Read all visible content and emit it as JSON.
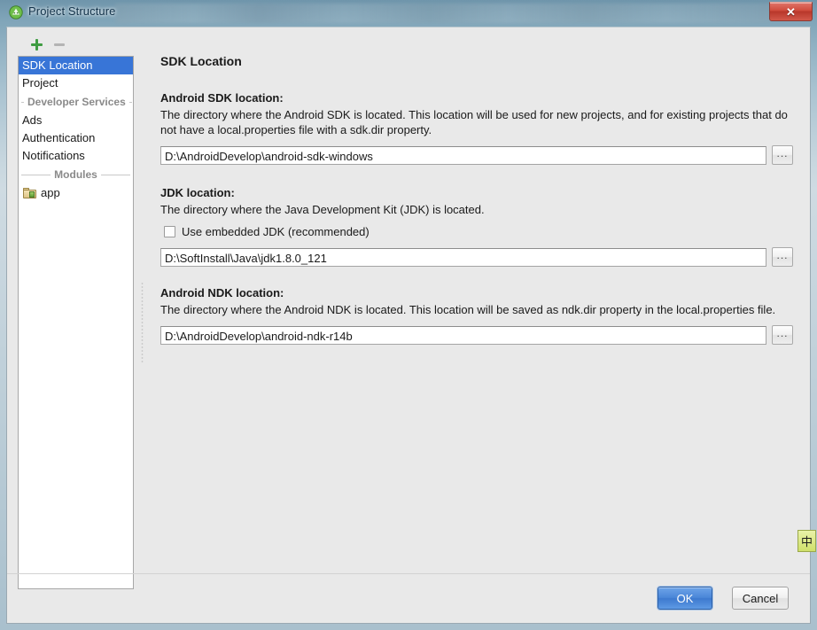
{
  "window": {
    "title": "Project Structure",
    "app_icon": "android-studio-icon",
    "close_label": "✕"
  },
  "sidebar": {
    "toolbar": {
      "add_label": "+",
      "remove_label": "−"
    },
    "items": [
      {
        "label": "SDK Location",
        "type": "item",
        "selected": true
      },
      {
        "label": "Project",
        "type": "item",
        "selected": false
      },
      {
        "label": "Developer Services",
        "type": "separator"
      },
      {
        "label": "Ads",
        "type": "item",
        "selected": false
      },
      {
        "label": "Authentication",
        "type": "item",
        "selected": false
      },
      {
        "label": "Notifications",
        "type": "item",
        "selected": false
      },
      {
        "label": "Modules",
        "type": "separator"
      },
      {
        "label": "app",
        "type": "item-icon",
        "selected": false,
        "icon": "module-folder-icon"
      }
    ]
  },
  "content": {
    "title": "SDK Location",
    "sections": [
      {
        "label": "Android SDK location:",
        "description": "The directory where the Android SDK is located. This location will be used for new projects, and for existing projects that do not have a local.properties file with a sdk.dir property.",
        "value": "D:\\AndroidDevelop\\android-sdk-windows",
        "placeholder": "",
        "browse_label": "..."
      },
      {
        "label": "JDK location:",
        "description": "The directory where the Java Development Kit (JDK) is located.",
        "checkbox_label": "Use embedded JDK (recommended)",
        "checkbox_checked": false,
        "value": "D:\\SoftInstall\\Java\\jdk1.8.0_121",
        "placeholder": "",
        "browse_label": "..."
      },
      {
        "label": "Android NDK location:",
        "description": "The directory where the Android NDK is located. This location will be saved as ndk.dir property in the local.properties file.",
        "value": "D:\\AndroidDevelop\\android-ndk-r14b",
        "placeholder": "",
        "browse_label": "..."
      }
    ]
  },
  "buttons": {
    "ok_label": "OK",
    "cancel_label": "Cancel"
  },
  "ime": {
    "label": "中"
  },
  "colors": {
    "selection_blue": "#3875d7",
    "default_button_blue": "#4a86d8",
    "dialog_background": "#e9e9e9",
    "close_button_red": "#cf4b3c",
    "add_icon_green": "#3f9c42"
  }
}
